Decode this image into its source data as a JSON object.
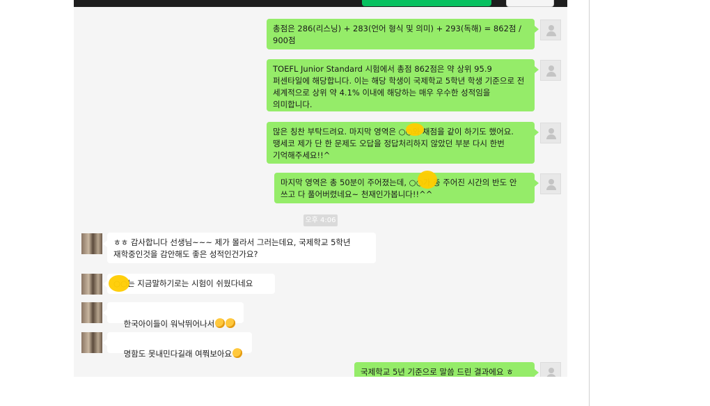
{
  "messages": [
    {
      "side": "me",
      "text": "총점은 286(리스닝) + 283(언어 형식 및 의미) + 293(독해) = 862점 / 900점"
    },
    {
      "side": "me",
      "text": "TOEFL Junior Standard 시험에서 총점 862점은 약 상위 95.9 퍼센타일에 해당합니다. 이는 해당 학생이 국제학교 5학년 학생 기준으로 전 세계적으로 상위 약 4.1% 이내에 해당하는 매우 우수한 성적임을 의미합니다."
    },
    {
      "side": "me",
      "text": "많은 칭찬 부탁드려요. 마지막 영역은 ○○와 채점을 같이 하기도 했어요. 땡세코 제가 단 한 문제도 오답을 정답처리하지 않았던 부분 다시 한번 기억해주세요!!^"
    },
    {
      "side": "me",
      "text": "마지막 영역은 총 50분이 주어졌는데, ○○가 총 주어진 시간의 반도 안 쓰고 다 풀어버렸네요~ 천재인가봅니다!!^^"
    },
    {
      "side": "other",
      "text": "ㅎㅎ 감사합니다 선생님~~~ 제가 몰라서 그러는데요, 국제학교 5학년 재학중인것을 감안해도 좋은 성적인건가요?"
    },
    {
      "side": "other",
      "text": "○○는 지금말하기로는 시험이 쉬웠다네요"
    },
    {
      "side": "other",
      "text": "한국아이들이 워낙뛰어나서"
    },
    {
      "side": "other",
      "text": "명함도 못내민다길래 여쭤보아요"
    },
    {
      "side": "me",
      "text": "국제학교 5년 기준으로 말씀 드린 결과에요 ㅎ"
    }
  ],
  "timestamp": "오후 4:06",
  "colors": {
    "my_bubble": "#95ec69",
    "their_bubble": "#ffffff",
    "chat_bg": "#f5f5f5",
    "accent_button": "#07c160"
  }
}
